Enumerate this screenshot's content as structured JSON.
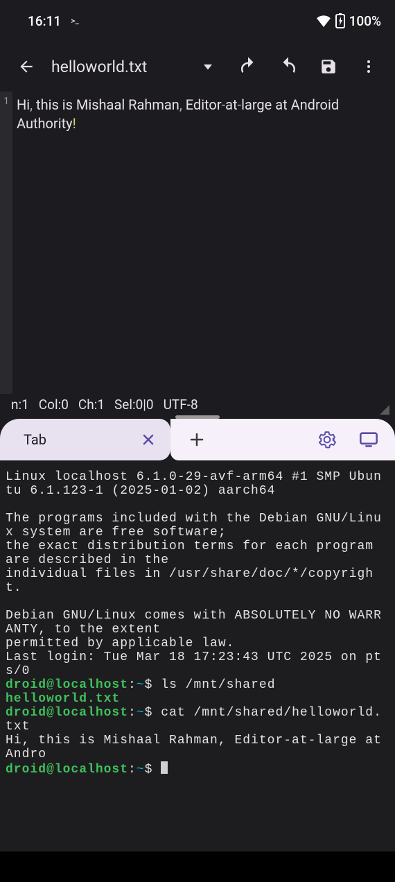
{
  "status": {
    "time": "16:11",
    "battery_text": "100%"
  },
  "editor": {
    "filename": "helloworld.txt",
    "line_number": "1",
    "content_parts": {
      "p1": "Hi",
      "c1": ", ",
      "p2": "this is Mishaal Rahman",
      "c2": ", ",
      "p3": "Editor",
      "d1": "-",
      "p4": "at",
      "d2": "-",
      "p5": "large at Android Authority",
      "ex": "!"
    },
    "status_line": {
      "ln": "n:1",
      "col": "Col:0",
      "ch": "Ch:1",
      "sel": "Sel:0|0",
      "enc": "UTF-8"
    }
  },
  "terminal": {
    "tab_label": "Tab",
    "lines": {
      "l1": "Linux localhost 6.1.0-29-avf-arm64 #1 SMP Ubuntu 6.1.123-1 (2025-01-02) aarch64",
      "l2": "",
      "l3": "The programs included with the Debian GNU/Linux system are free software;",
      "l4": "the exact distribution terms for each program are described in the",
      "l5": "individual files in /usr/share/doc/*/copyright.",
      "l6": "",
      "l7": "Debian GNU/Linux comes with ABSOLUTELY NO WARRANTY, to the extent",
      "l8": "permitted by applicable law.",
      "l9": "Last login: Tue Mar 18 17:23:43 UTC 2025 on pts/0"
    },
    "prompt": {
      "userhost": "droid@localhost",
      "sep": ":",
      "path": "~",
      "sigil": "$ "
    },
    "cmd1": "ls /mnt/shared",
    "out1": "helloworld.txt",
    "cmd2": "cat /mnt/shared/helloworld.txt",
    "out2": "Hi, this is Mishaal Rahman, Editor-at-large at Andro"
  }
}
